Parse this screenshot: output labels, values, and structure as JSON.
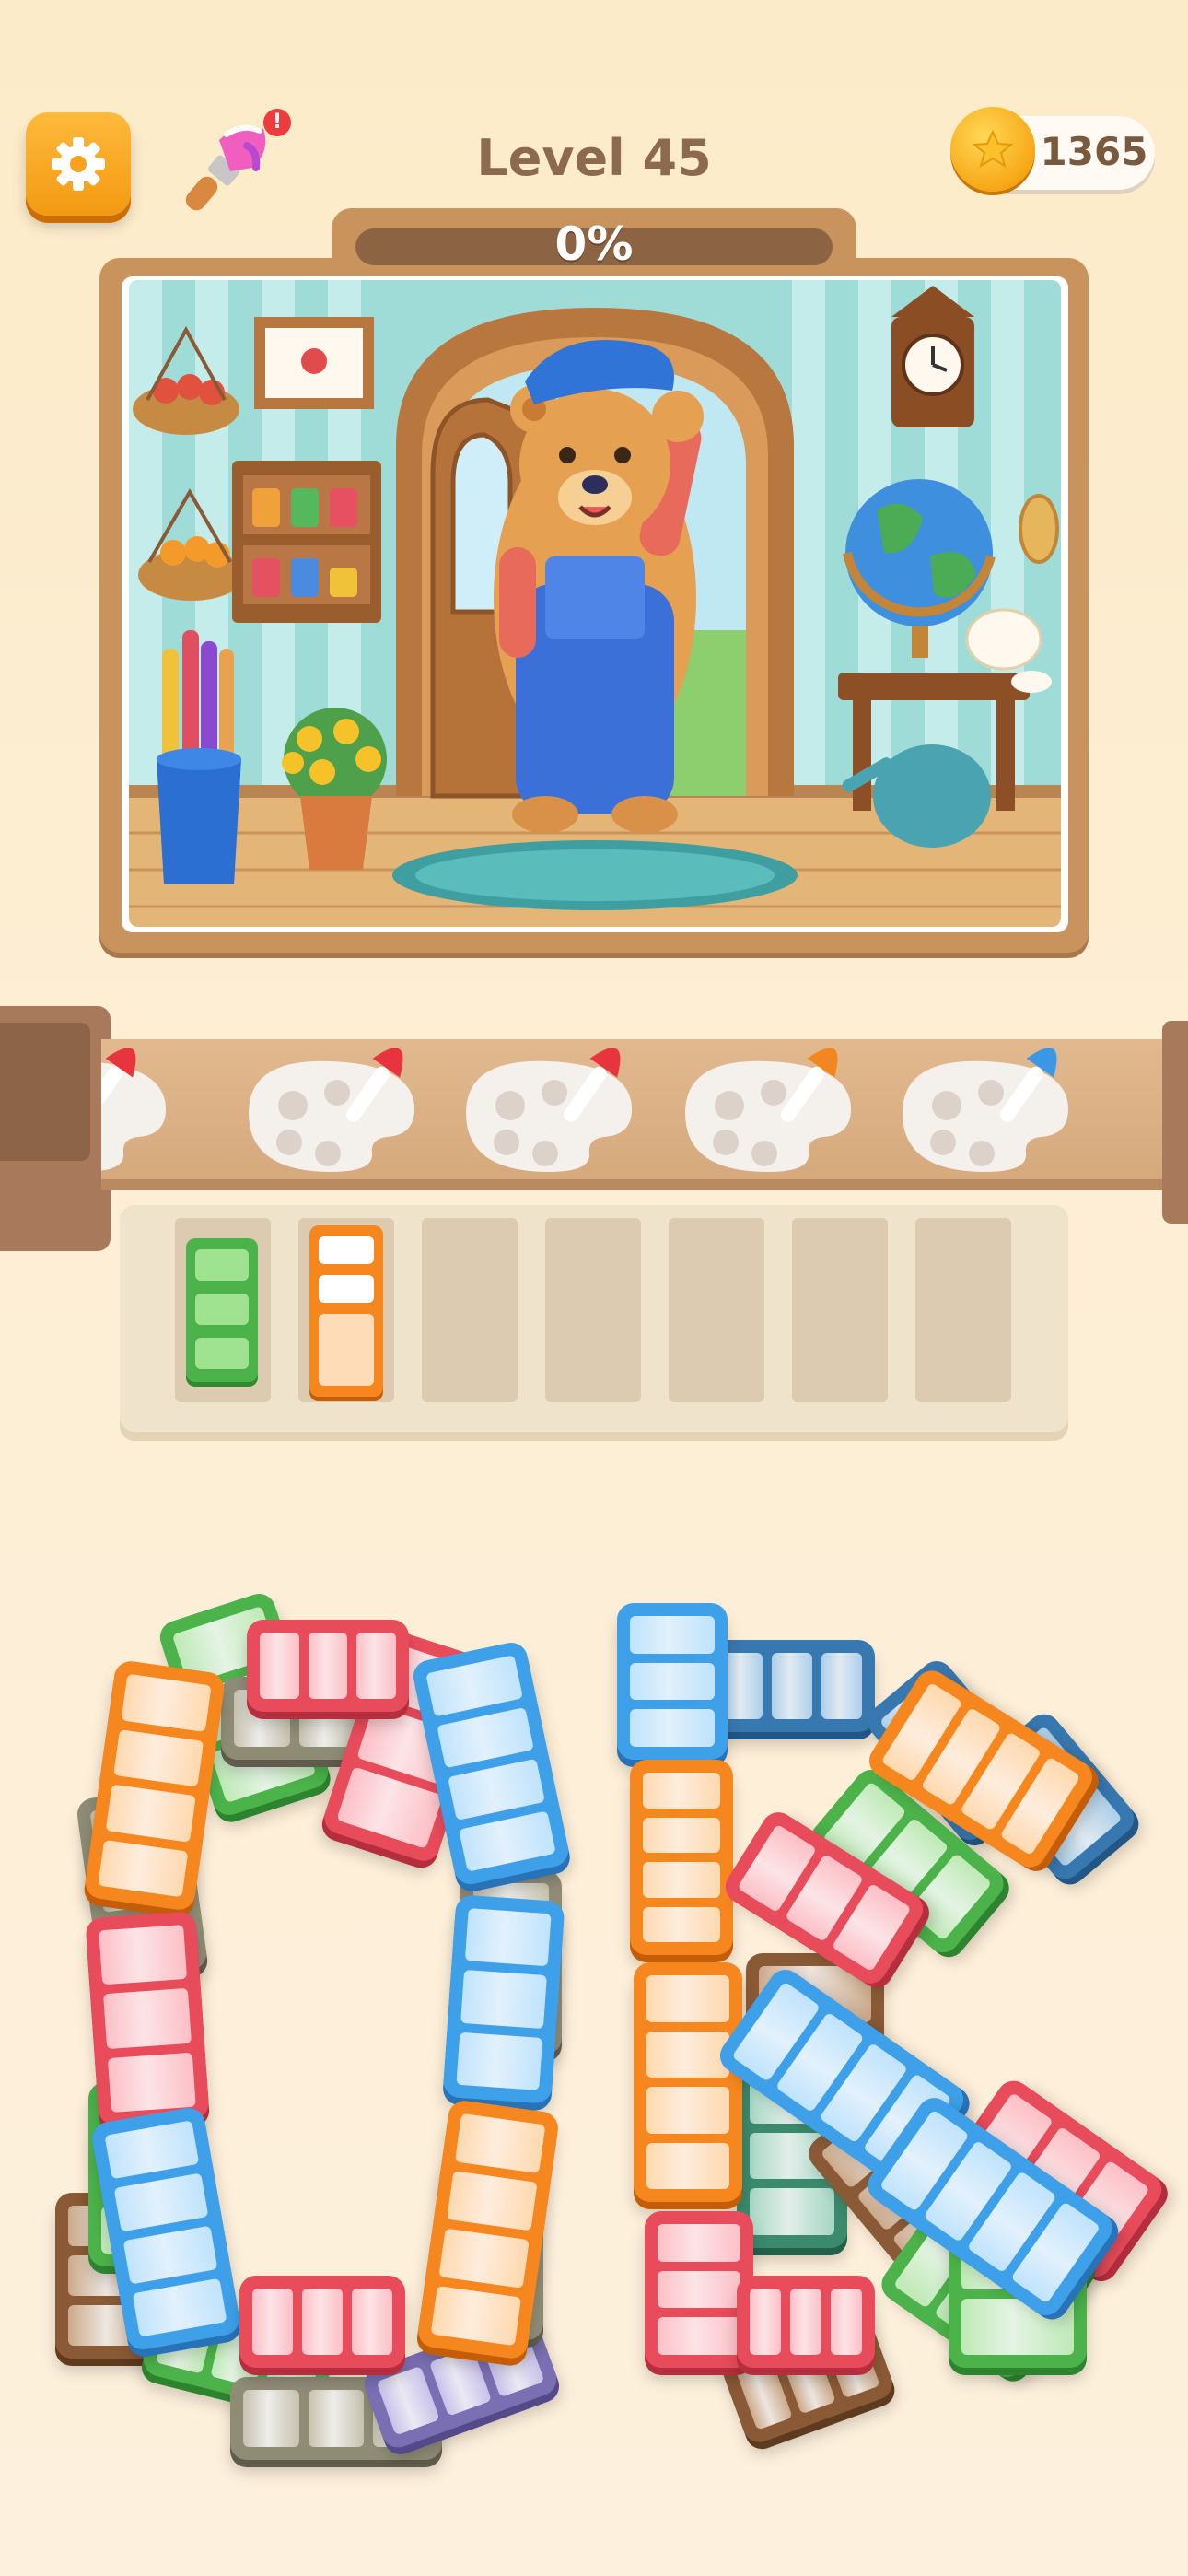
{
  "header": {
    "level_title": "Level 45",
    "coins": "1365",
    "settings_icon": "gear-icon",
    "paint_icon": "paintbrush-icon",
    "notification_icon": "exclamation-badge-icon"
  },
  "puzzle": {
    "progress_text": "0%",
    "progress_value": 0
  },
  "conveyor": {
    "brushes": [
      "red",
      "red",
      "red",
      "orange",
      "blue"
    ]
  },
  "slots": {
    "total": 7,
    "filled": [
      "green",
      "orange"
    ]
  },
  "colors": {
    "orange": "#f6861e",
    "red": "#e84b5a",
    "blue": "#3ea0e8",
    "green": "#4cb34a",
    "gray": "#8f8c76",
    "purple": "#7a6fb2",
    "brown": "#8a5a36",
    "darkblue": "#3878b0",
    "teal": "#3b8a6e"
  }
}
